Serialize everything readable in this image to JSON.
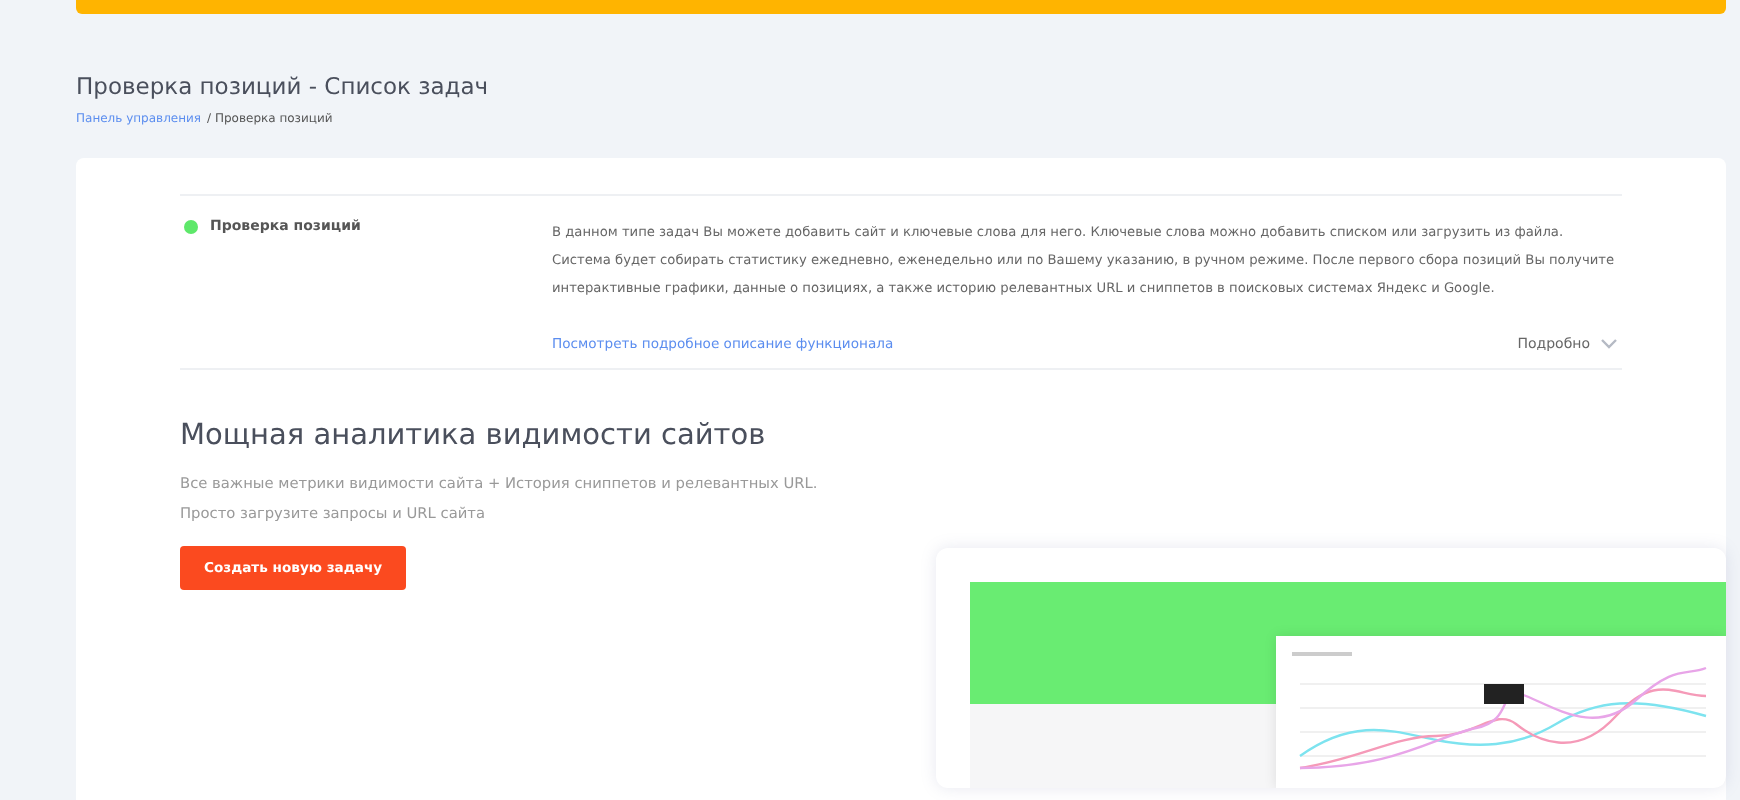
{
  "page": {
    "title": "Проверка позиций - Список задач"
  },
  "breadcrumb": [
    {
      "label": "Панель управления",
      "kind": "link"
    },
    {
      "label": "/ Проверка позиций",
      "kind": "current"
    }
  ],
  "task_type": {
    "name": "Проверка позиций",
    "color": "#5ee86a",
    "description": "В данном типе задач Вы можете добавить сайт и ключевые слова для него. Ключевые слова можно добавить списком или загрузить из файла. Система будет собирать статистику ежедневно, еженедельно или по Вашему указанию, в ручном режиме. После первого сбора позиций Вы получите интерактивные графики, данные о позициях, а также историю релевантных URL и сниппетов в поисковых системах Яндекс и Google.",
    "link": "Посмотреть подробное описание функционала",
    "details": {
      "label": "Подробно",
      "expanded": false
    }
  },
  "promo": {
    "heading": "Мощная аналитика видимости сайтов",
    "lines": [
      "Все важные метрики видимости сайта + История сниппетов и релевантных URL.",
      "Просто загрузите запросы и URL сайта"
    ],
    "button": "Создать новую задачу"
  }
}
